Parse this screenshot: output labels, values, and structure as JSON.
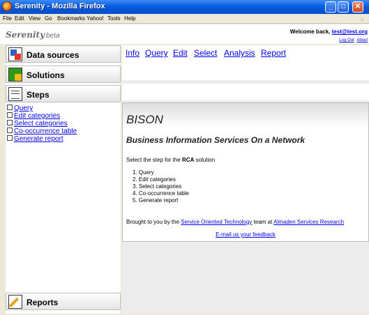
{
  "window": {
    "title": "Serenity - Mozilla Firefox"
  },
  "menu": [
    "File",
    "Edit",
    "View",
    "Go",
    "Bookmarks",
    "Yahoo!",
    "Tools",
    "Help"
  ],
  "header": {
    "brand": "Serenity",
    "brand_suffix": "beta",
    "welcome_prefix": "Welcome back,",
    "user": "test@test.org",
    "logout": "Log Out",
    "about": "About"
  },
  "sidebar": {
    "data_sources": "Data sources",
    "solutions": "Solutions",
    "steps": "Steps",
    "reports": "Reports",
    "step_items": [
      "Query",
      "Edit categories",
      "Select categories",
      "Co-occurrence table",
      "Generate report"
    ]
  },
  "tabs": [
    "Info",
    "Query",
    "Edit",
    "Select",
    "Analysis",
    "Report"
  ],
  "content": {
    "title": "BISON",
    "subtitle": "Business Information Services On a Network",
    "intro_prefix": "Select the step for the ",
    "intro_strong": "RCA",
    "intro_suffix": " solution",
    "steps": [
      "1.  Query",
      "2.  Edit categories",
      "3.  Select categories",
      "4.  Co-occurrence table",
      "5.  Generate report"
    ],
    "credits_prefix": "Brought to you by the ",
    "credits_link1": "Service Oriented Technology",
    "credits_mid": " team at ",
    "credits_link2": "Almaden Services Research",
    "feedback": "E-mail us your feedback"
  }
}
